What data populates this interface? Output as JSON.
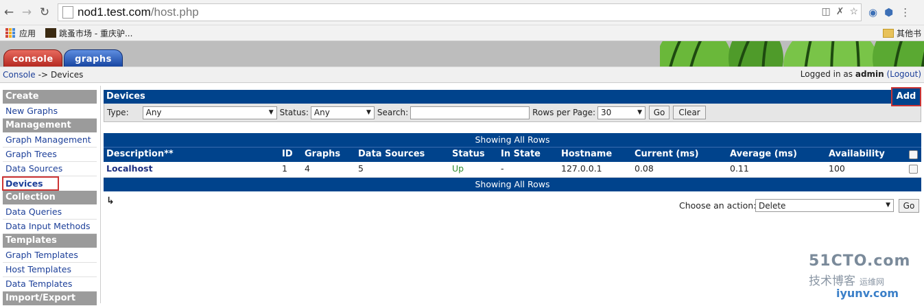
{
  "browser": {
    "url_host": "nod1.test.com",
    "url_path": "/host.php",
    "bookmarks": [
      {
        "label": "应用"
      },
      {
        "label": "跳蚤市场 - 重庆驴..."
      }
    ],
    "bookmarks_right": "其他书"
  },
  "header": {
    "tabs": [
      {
        "label": "console",
        "color": "#c0392b"
      },
      {
        "label": "graphs",
        "color": "#1f4ea8"
      }
    ],
    "breadcrumb": {
      "link": "Console",
      "sep": "->",
      "current": "Devices"
    },
    "login_prefix": "Logged in as",
    "user": "admin",
    "logout": "(Logout)"
  },
  "sidebar": {
    "sections": [
      {
        "title": "Create",
        "items": [
          "New Graphs"
        ]
      },
      {
        "title": "Management",
        "items": [
          "Graph Management",
          "Graph Trees",
          "Data Sources",
          "Devices"
        ]
      },
      {
        "title": "Collection Methods",
        "items": [
          "Data Queries",
          "Data Input Methods"
        ]
      },
      {
        "title": "Templates",
        "items": [
          "Graph Templates",
          "Host Templates",
          "Data Templates"
        ]
      },
      {
        "title": "Import/Export",
        "items": []
      }
    ],
    "active": "Devices"
  },
  "panel": {
    "title": "Devices",
    "add_label": "Add",
    "type_label": "Type:",
    "type_value": "Any",
    "status_label": "Status:",
    "status_value": "Any",
    "search_label": "Search:",
    "search_value": "",
    "rows_label": "Rows per Page:",
    "rows_value": "30",
    "go_label": "Go",
    "clear_label": "Clear"
  },
  "table": {
    "showing_top": "Showing All Rows",
    "showing_bottom": "Showing All Rows",
    "columns": [
      "Description**",
      "ID",
      "Graphs",
      "Data Sources",
      "Status",
      "In State",
      "Hostname",
      "Current (ms)",
      "Average (ms)",
      "Availability"
    ],
    "rows": [
      {
        "description": "Localhost",
        "id": "1",
        "graphs": "4",
        "data_sources": "5",
        "status": "Up",
        "in_state": "-",
        "hostname": "127.0.0.1",
        "current": "0.08",
        "average": "0.11",
        "availability": "100"
      }
    ],
    "status_up_color": "#2e8b2e"
  },
  "actions": {
    "label": "Choose an action:",
    "value": "Delete",
    "go_label": "Go"
  },
  "watermark": {
    "line1": "51CTO.com",
    "line2": "技术博客",
    "line3": "运维网",
    "line4": "iyunv.com"
  }
}
